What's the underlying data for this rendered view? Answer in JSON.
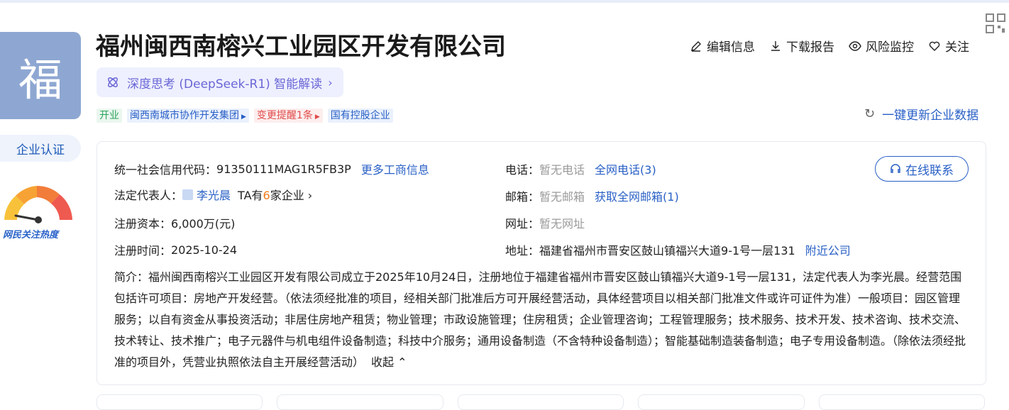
{
  "company": {
    "logo_char": "福",
    "name": "福州闽西南榕兴工业园区开发有限公司",
    "ai_button": "深度思考 (DeepSeek-R1) 智能解读",
    "tags": [
      "开业",
      "闽西南城市协作开发集团",
      "变更提醒1条",
      "国有控股企业"
    ],
    "cert_button": "企业认证",
    "heat_label": "网民关注热度"
  },
  "actions": {
    "edit": "编辑信息",
    "download": "下载报告",
    "monitor": "风险监控",
    "follow": "关注"
  },
  "refresh": "一键更新企业数据",
  "info": {
    "credit_label": "统一社会信用代码：",
    "credit_value": "91350111MAG1R5FB3P",
    "credit_link": "更多工商信息",
    "legal_label": "法定代表人：",
    "legal_name": "李光晨",
    "legal_pre": "TA有",
    "legal_count": "6",
    "legal_post": "家企业",
    "capital_label": "注册资本：",
    "capital_value": "6,000万(元)",
    "date_label": "注册时间：",
    "date_value": "2025-10-24",
    "phone_label": "电话：",
    "phone_value": "暂无电话",
    "phone_link": "全网电话(3)",
    "email_label": "邮箱：",
    "email_value": "暂无邮箱",
    "email_link": "获取全网邮箱(1)",
    "web_label": "网址：",
    "web_value": "暂无网址",
    "addr_label": "地址：",
    "addr_value": "福建省福州市晋安区鼓山镇福兴大道9-1号一层131",
    "addr_link": "附近公司",
    "online_button": "在线联系",
    "intro": "简介：福州闽西南榕兴工业园区开发有限公司成立于2025年10月24日，注册地位于福建省福州市晋安区鼓山镇福兴大道9-1号一层131，法定代表人为李光晨。经营范围包括许可项目：房地产开发经营。（依法须经批准的项目，经相关部门批准后方可开展经营活动，具体经营项目以相关部门批准文件或许可证件为准）一般项目：园区管理服务；以自有资金从事投资活动；非居住房地产租赁；物业管理；市政设施管理；住房租赁；企业管理咨询；工程管理服务；技术服务、技术开发、技术咨询、技术交流、技术转让、技术推广；电子元器件与机电组件设备制造；科技中介服务；通用设备制造（不含特种设备制造）；智能基础制造装备制造；电子专用设备制造。（除依法须经批准的项目外，凭营业执照依法自主开展经营活动）",
    "collapse": "收起"
  }
}
